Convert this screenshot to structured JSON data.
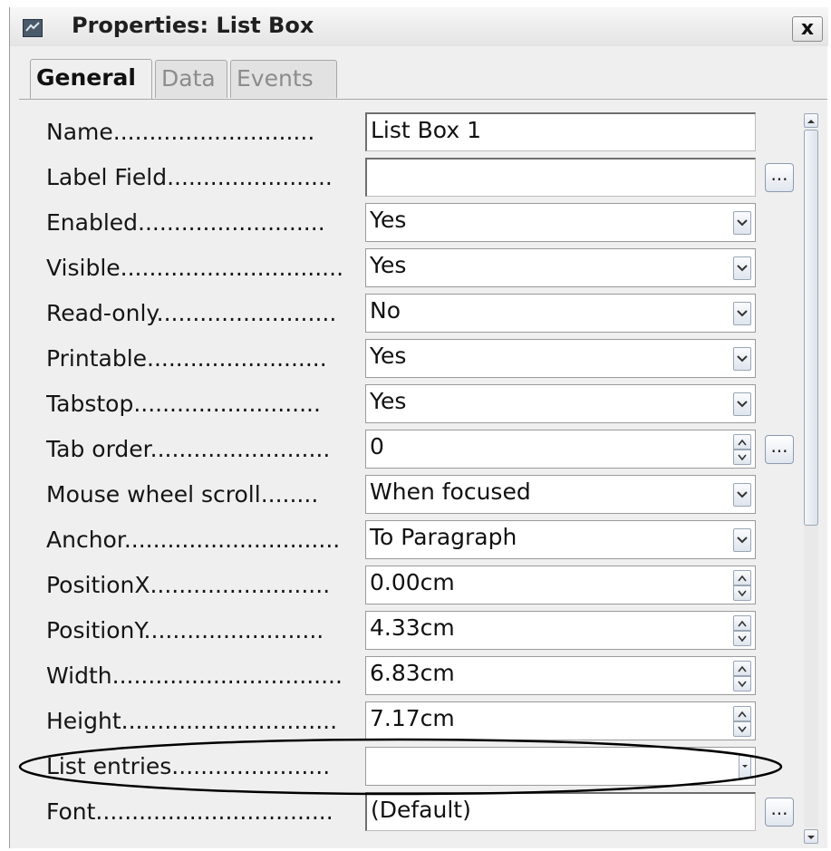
{
  "window": {
    "title": "Properties: List Box",
    "close_label": "x"
  },
  "tabs": [
    {
      "label": "General",
      "active": true
    },
    {
      "label": "Data",
      "active": false
    },
    {
      "label": "Events",
      "active": false
    }
  ],
  "properties": [
    {
      "label": "Name............................",
      "type": "text",
      "value": "List Box 1",
      "ellipsis": false
    },
    {
      "label": "Label Field.......................",
      "type": "text",
      "value": "",
      "ellipsis": true
    },
    {
      "label": "Enabled..........................",
      "type": "dropdown",
      "value": "Yes",
      "ellipsis": false
    },
    {
      "label": "Visible...............................",
      "type": "dropdown",
      "value": "Yes",
      "ellipsis": false
    },
    {
      "label": "Read-only.........................",
      "type": "dropdown",
      "value": "No",
      "ellipsis": false
    },
    {
      "label": "Printable.........................",
      "type": "dropdown",
      "value": "Yes",
      "ellipsis": false
    },
    {
      "label": "Tabstop..........................",
      "type": "dropdown",
      "value": "Yes",
      "ellipsis": false
    },
    {
      "label": "Tab order.........................",
      "type": "spin",
      "value": "0",
      "ellipsis": true
    },
    {
      "label": "Mouse wheel scroll........",
      "type": "dropdown",
      "value": "When focused",
      "ellipsis": false
    },
    {
      "label": "Anchor..............................",
      "type": "dropdown",
      "value": "To Paragraph",
      "ellipsis": false
    },
    {
      "label": "PositionX.........................",
      "type": "spin",
      "value": "0.00cm",
      "ellipsis": false
    },
    {
      "label": "PositionY.........................",
      "type": "spin",
      "value": "4.33cm",
      "ellipsis": false
    },
    {
      "label": "Width................................",
      "type": "spin",
      "value": "6.83cm",
      "ellipsis": false
    },
    {
      "label": "Height..............................",
      "type": "spin",
      "value": "7.17cm",
      "ellipsis": false
    },
    {
      "label": "List entries......................",
      "type": "dropdown-small",
      "value": "",
      "ellipsis": false,
      "highlighted": true
    },
    {
      "label": "Font.................................",
      "type": "text",
      "value": "(Default)",
      "ellipsis": true
    }
  ],
  "ellipsis_label": "...",
  "icons": {
    "app": "form-properties-icon",
    "dropdown": "chevron-down-icon",
    "spin_up": "spin-up-icon",
    "spin_down": "spin-down-icon",
    "scroll_up": "scroll-up-icon",
    "scroll_down": "scroll-down-icon"
  },
  "colors": {
    "dialog_bg": "#efefef",
    "field_bg": "#ffffff",
    "button_border": "#9aa6b5",
    "annotation": "#000000"
  }
}
